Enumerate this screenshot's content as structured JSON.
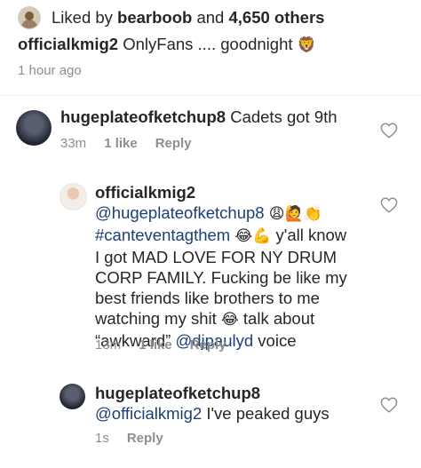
{
  "likes": {
    "prefix": "Liked by ",
    "user": "bearboob",
    "middle": " and ",
    "count": "4,650 others"
  },
  "caption": {
    "username": "officialkmig2",
    "text": " OnlyFans .... goodnight ",
    "emoji": "🦁"
  },
  "post_time": "1 hour ago",
  "comments": [
    {
      "username": "hugeplateofketchup8",
      "text": " Cadets got 9th",
      "time": "33m",
      "likes": "1 like",
      "reply": "Reply"
    },
    {
      "username": "officialkmig2",
      "mention": "@hugeplateofketchup8",
      "emojis1": "😩🙋👏",
      "hashtag": "#canteventagthem",
      "emojis2": "😂💪",
      "text1": " y'all know",
      "line3": "I got MAD LOVE FOR NY DRUM",
      "line4": "CORP FAMILY. Fucking be like my",
      "line5": "best friends like brothers to me",
      "line6a": "watching my shit ",
      "emoji3": "😂",
      "line6b": " talk about",
      "line7a": "“awkward” ",
      "mention2": "@djpaulyd",
      "line7b": " voice",
      "time": "13m",
      "likes": "1 like",
      "reply": "Reply"
    },
    {
      "username": "hugeplateofketchup8",
      "mention": "@officialkmig2",
      "text": " I've peaked guys",
      "time": "1s",
      "reply": "Reply"
    }
  ]
}
